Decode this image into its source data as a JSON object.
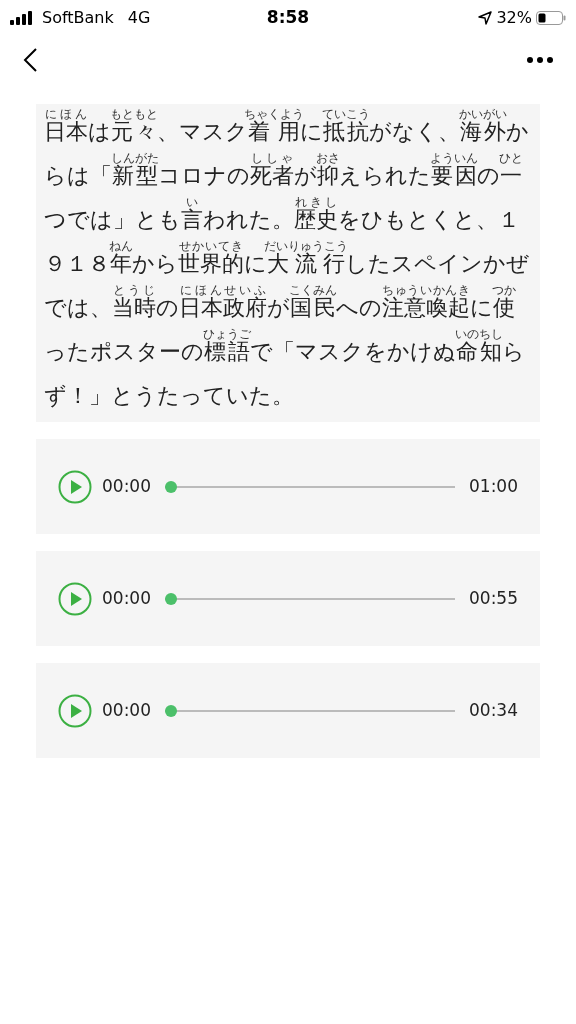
{
  "status_bar": {
    "carrier": "SoftBank",
    "network": "4G",
    "time": "8:58",
    "battery": "32%"
  },
  "article": {
    "segments": [
      {
        "text": "日本",
        "ruby": "にほん"
      },
      {
        "text": "は"
      },
      {
        "text": "元々",
        "ruby": "もともと"
      },
      {
        "text": "、マスク"
      },
      {
        "text": "着用",
        "ruby": "ちゃくよう"
      },
      {
        "text": "に"
      },
      {
        "text": "抵抗",
        "ruby": "ていこう"
      },
      {
        "text": "がなく、"
      },
      {
        "text": "海外",
        "ruby": "かいがい"
      },
      {
        "text": "からは「"
      },
      {
        "text": "新型",
        "ruby": "しんがた"
      },
      {
        "text": "コロナの"
      },
      {
        "text": "死者",
        "ruby": "ししゃ"
      },
      {
        "text": "が"
      },
      {
        "text": "抑",
        "ruby": "おさ"
      },
      {
        "text": "えられた"
      },
      {
        "text": "要因",
        "ruby": "よういん"
      },
      {
        "text": "の"
      },
      {
        "text": "一",
        "ruby": "ひと"
      },
      {
        "text": "つでは」とも"
      },
      {
        "text": "言",
        "ruby": "い"
      },
      {
        "text": "われた。"
      },
      {
        "text": "歴史",
        "ruby": "れきし"
      },
      {
        "text": "をひもとくと、１９１８"
      },
      {
        "text": "年",
        "ruby": "ねん"
      },
      {
        "text": "から"
      },
      {
        "text": "世界的",
        "ruby": "せかいてき"
      },
      {
        "text": "に"
      },
      {
        "text": "大流行",
        "ruby": "だいりゅうこう"
      },
      {
        "text": "したスペインかぜでは、"
      },
      {
        "text": "当時",
        "ruby": "とうじ"
      },
      {
        "text": "の"
      },
      {
        "text": "日本政府",
        "ruby": "にほんせいふ"
      },
      {
        "text": "が"
      },
      {
        "text": "国民",
        "ruby": "こくみん"
      },
      {
        "text": "への"
      },
      {
        "text": "注意喚起",
        "ruby": "ちゅういかんき"
      },
      {
        "text": "に"
      },
      {
        "text": "使",
        "ruby": "つか"
      },
      {
        "text": "ったポスターの"
      },
      {
        "text": "標語",
        "ruby": "ひょうご"
      },
      {
        "text": "で「マスクをかけぬ"
      },
      {
        "text": "命知",
        "ruby": "いのちし"
      },
      {
        "text": "らず！」とうたっていた。"
      }
    ]
  },
  "players": [
    {
      "current": "00:00",
      "duration": "01:00",
      "level": 0
    },
    {
      "current": "00:00",
      "duration": "00:55",
      "level": 0
    },
    {
      "current": "00:00",
      "duration": "00:34",
      "level": 0
    }
  ]
}
